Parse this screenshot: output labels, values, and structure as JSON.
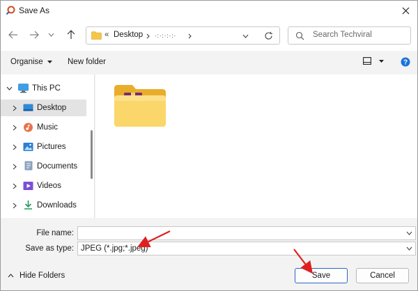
{
  "window": {
    "title": "Save As"
  },
  "address": {
    "prefix": "«",
    "crumbs": [
      "Desktop",
      "·:·:·:·:·"
    ]
  },
  "search": {
    "placeholder": "Search Techviral"
  },
  "toolbar": {
    "organise_label": "Organise",
    "new_folder_label": "New folder"
  },
  "sidebar": {
    "items": [
      {
        "label": "This PC",
        "icon": "pc-icon"
      },
      {
        "label": "Desktop",
        "icon": "desktop-icon"
      },
      {
        "label": "Music",
        "icon": "music-icon"
      },
      {
        "label": "Pictures",
        "icon": "pictures-icon"
      },
      {
        "label": "Documents",
        "icon": "documents-icon"
      },
      {
        "label": "Videos",
        "icon": "videos-icon"
      },
      {
        "label": "Downloads",
        "icon": "downloads-icon"
      }
    ]
  },
  "form": {
    "file_name_label": "File name:",
    "file_name_value": "",
    "save_type_label": "Save as type:",
    "save_type_value": "JPEG (*.jpg;*.jpeg)"
  },
  "footer": {
    "hide_folders_label": "Hide Folders",
    "save_label": "Save",
    "cancel_label": "Cancel"
  },
  "colors": {
    "accent": "#2d67c4",
    "annotation_arrow": "#e02020",
    "folder": "#f5c64a"
  }
}
